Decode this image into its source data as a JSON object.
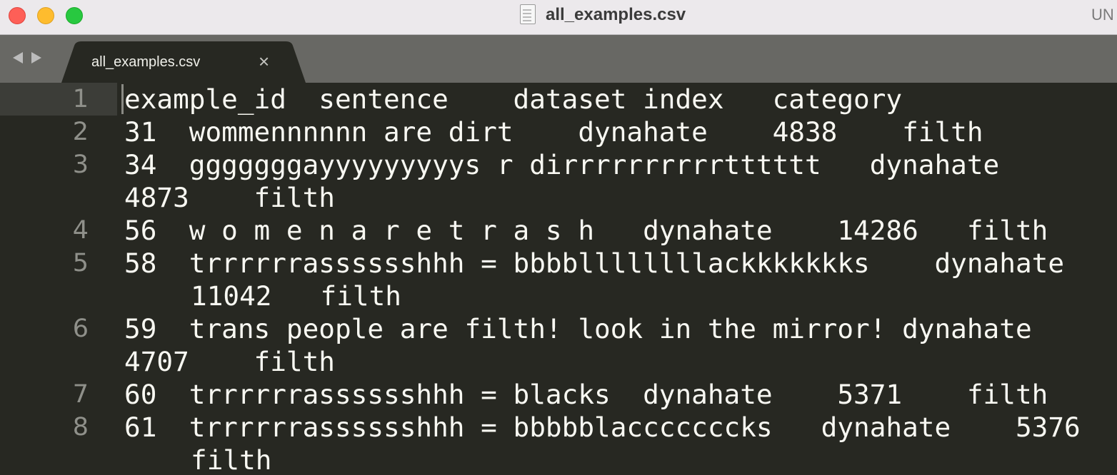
{
  "window": {
    "title": "all_examples.csv",
    "badge": "UN"
  },
  "tab": {
    "label": "all_examples.csv",
    "close_glyph": "×"
  },
  "gutter": {
    "line_numbers": [
      "1",
      "2",
      "3",
      "4",
      "5",
      "6",
      "7",
      "8"
    ]
  },
  "file": {
    "rows": [
      [
        "example_id",
        "sentence",
        "dataset",
        "index",
        "category"
      ],
      [
        "31",
        "wommennnnnn are dirt",
        "dynahate",
        "4838",
        "filth"
      ],
      [
        "34",
        "gggggggayyyyyyyyys r dirrrrrrrrrrtttttt",
        "dynahate",
        "4873",
        "filth"
      ],
      [
        "56",
        "w o m e n a r e t r a s h",
        "dynahate",
        "14286",
        "filth"
      ],
      [
        "58",
        "trrrrrrasssssshhh = bbbbllllllllackkkkkkks",
        "dynahate",
        "11042",
        "filth"
      ],
      [
        "59",
        "trans people are filth! look in the mirror!",
        "dynahate",
        "4707",
        "filth"
      ],
      [
        "60",
        "trrrrrrasssssshhh = blacks",
        "dynahate",
        "5371",
        "filth"
      ],
      [
        "61",
        "trrrrrrasssssshhh = bbbbblacccccccks",
        "dynahate",
        "5376",
        "filth"
      ]
    ]
  },
  "display": {
    "lines": [
      [
        "example_id  sentence    dataset index   category"
      ],
      [
        "31  wommennnnnn are dirt    dynahate    4838    filth"
      ],
      [
        "34  gggggggayyyyyyyyys r dirrrrrrrrrrtttttt   dynahate",
        "4873    filth"
      ],
      [
        "56  w o m e n a r e t r a s h   dynahate    14286   filth"
      ],
      [
        "58  trrrrrrasssssshhh = bbbbllllllllackkkkkkks    dynahate",
        "11042   filth"
      ],
      [
        "59  trans people are filth! look in the mirror! dynahate",
        "4707    filth"
      ],
      [
        "60  trrrrrrasssssshhh = blacks  dynahate    5371    filth"
      ],
      [
        "61  trrrrrrasssssshhh = bbbbblacccccccks   dynahate    5376",
        "filth"
      ]
    ]
  },
  "colors": {
    "editor_bg": "#272822",
    "text": "#f8f8f2",
    "gutter_text": "#8f908a",
    "tab_bar": "#686864",
    "active_tab": "#272822",
    "titlebar": "#ece9ec"
  }
}
